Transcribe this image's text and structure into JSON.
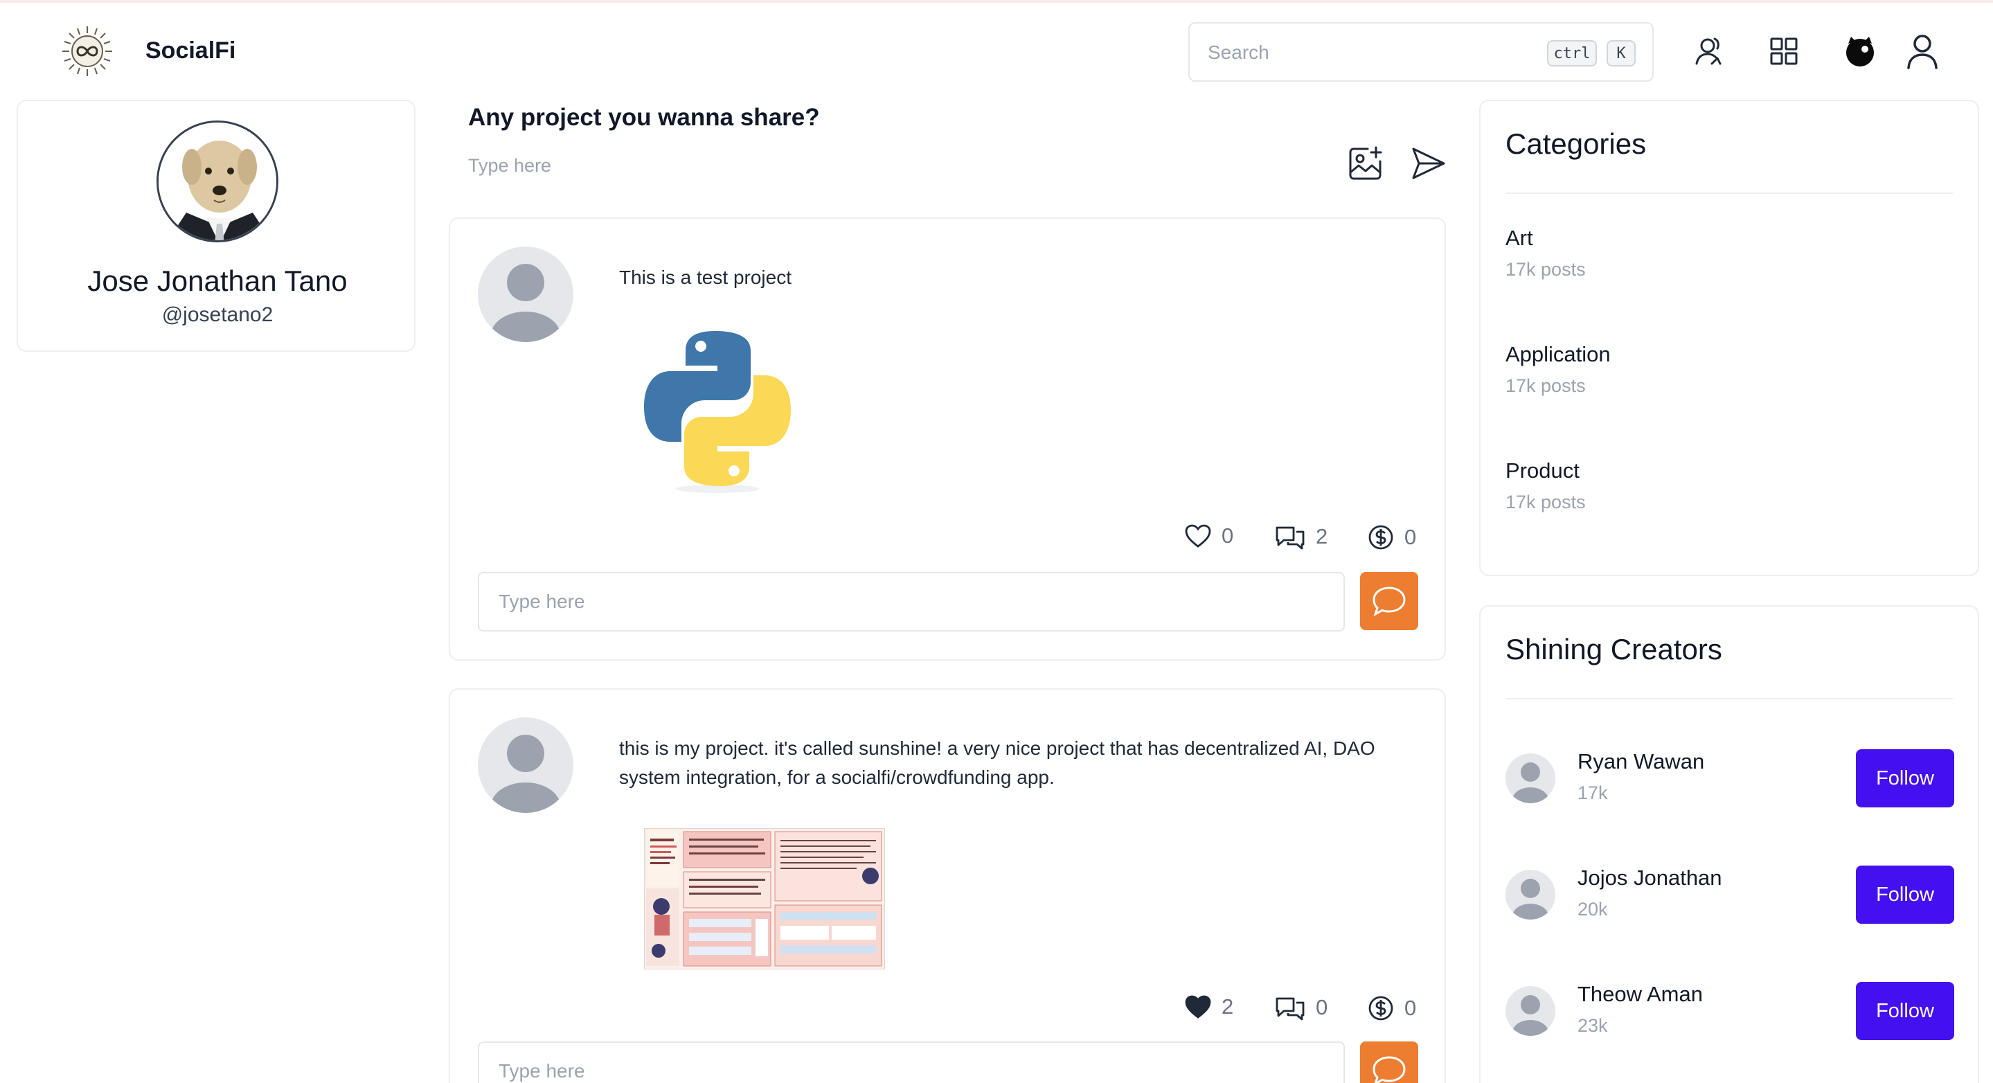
{
  "app": {
    "brand": "SocialFi"
  },
  "search": {
    "placeholder": "Search",
    "shortcut_ctrl": "ctrl",
    "shortcut_key": "K"
  },
  "header_icons": [
    "friends-icon",
    "grid-icon",
    "avatar-badge-icon",
    "user-icon"
  ],
  "profile": {
    "name": "Jose Jonathan Tano",
    "handle": "@josetano2"
  },
  "composer": {
    "title": "Any project you wanna share?",
    "placeholder": "Type here"
  },
  "posts": [
    {
      "text": "This is a test project",
      "image": "python-logo",
      "likes": "0",
      "liked": false,
      "comments": "2",
      "donations": "0",
      "comment_placeholder": "Type here"
    },
    {
      "text": "this is my project. it's called sunshine! a very nice project that has decentralized AI, DAO system integration, for a socialfi/crowdfunding app.",
      "image": "project-poster",
      "likes": "2",
      "liked": true,
      "comments": "0",
      "donations": "0",
      "comment_placeholder": "Type here"
    }
  ],
  "categories": {
    "title": "Categories",
    "items": [
      {
        "name": "Art",
        "count": "17k posts"
      },
      {
        "name": "Application",
        "count": "17k posts"
      },
      {
        "name": "Product",
        "count": "17k posts"
      }
    ]
  },
  "creators": {
    "title": "Shining Creators",
    "follow_label": "Follow",
    "items": [
      {
        "name": "Ryan Wawan",
        "count": "17k"
      },
      {
        "name": "Jojos Jonathan",
        "count": "20k"
      },
      {
        "name": "Theow Aman",
        "count": "23k"
      }
    ]
  },
  "colors": {
    "accent_orange": "#ed7d31",
    "follow_purple": "#4410f0"
  }
}
